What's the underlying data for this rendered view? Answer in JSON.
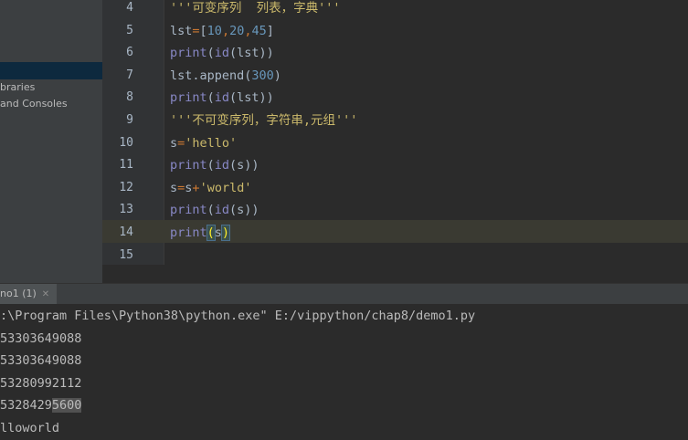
{
  "sidebar": {
    "items": [
      {
        "label": "braries"
      },
      {
        "label": "and Consoles"
      }
    ]
  },
  "editor": {
    "line_numbers": [
      "4",
      "5",
      "6",
      "7",
      "8",
      "9",
      "10",
      "11",
      "12",
      "13",
      "14",
      "15"
    ],
    "lines": [
      [
        {
          "t": "'''可变序列  列表，字典'''",
          "c": "str"
        }
      ],
      [
        {
          "t": "lst",
          "c": "plain"
        },
        {
          "t": "=",
          "c": "op"
        },
        {
          "t": "[",
          "c": "plain"
        },
        {
          "t": "10",
          "c": "num"
        },
        {
          "t": ",",
          "c": "op"
        },
        {
          "t": "20",
          "c": "num"
        },
        {
          "t": ",",
          "c": "op"
        },
        {
          "t": "45",
          "c": "num"
        },
        {
          "t": "]",
          "c": "plain"
        }
      ],
      [
        {
          "t": "print",
          "c": "fn"
        },
        {
          "t": "(",
          "c": "plain"
        },
        {
          "t": "id",
          "c": "fn"
        },
        {
          "t": "(lst))",
          "c": "plain"
        }
      ],
      [
        {
          "t": "lst.append(",
          "c": "plain"
        },
        {
          "t": "300",
          "c": "num"
        },
        {
          "t": ")",
          "c": "plain"
        }
      ],
      [
        {
          "t": "print",
          "c": "fn"
        },
        {
          "t": "(",
          "c": "plain"
        },
        {
          "t": "id",
          "c": "fn"
        },
        {
          "t": "(lst))",
          "c": "plain"
        }
      ],
      [
        {
          "t": "'''不可变序列，字符串,元组'''",
          "c": "str"
        }
      ],
      [
        {
          "t": "s",
          "c": "plain"
        },
        {
          "t": "=",
          "c": "op"
        },
        {
          "t": "'hello'",
          "c": "str"
        }
      ],
      [
        {
          "t": "print",
          "c": "fn"
        },
        {
          "t": "(",
          "c": "plain"
        },
        {
          "t": "id",
          "c": "fn"
        },
        {
          "t": "(s))",
          "c": "plain"
        }
      ],
      [
        {
          "t": "s",
          "c": "plain"
        },
        {
          "t": "=",
          "c": "op"
        },
        {
          "t": "s",
          "c": "plain"
        },
        {
          "t": "+",
          "c": "op"
        },
        {
          "t": "'world'",
          "c": "str"
        }
      ],
      [
        {
          "t": "print",
          "c": "fn"
        },
        {
          "t": "(",
          "c": "plain"
        },
        {
          "t": "id",
          "c": "fn"
        },
        {
          "t": "(s))",
          "c": "plain"
        }
      ],
      [
        {
          "t": "print",
          "c": "fn"
        },
        {
          "t": "(",
          "c": "bracket"
        },
        {
          "t": "s",
          "c": "plain"
        },
        {
          "t": ")",
          "c": "bracket"
        }
      ],
      []
    ]
  },
  "run_panel": {
    "tab_label": "no1 (1)",
    "close_icon": "close-icon"
  },
  "console": {
    "lines": [
      ":\\Program Files\\Python38\\python.exe\" E:/vippython/chap8/demo1.py",
      "53303649088",
      "53303649088",
      "53280992112",
      "53284295600",
      "lloworld"
    ]
  },
  "colors": {
    "string": "#cbb96b",
    "keyword_op": "#cc7832",
    "number": "#6897bb",
    "builtin": "#8888c6",
    "text": "#a9b7c6",
    "background": "#2b2b2b",
    "panel": "#3c3f41"
  }
}
